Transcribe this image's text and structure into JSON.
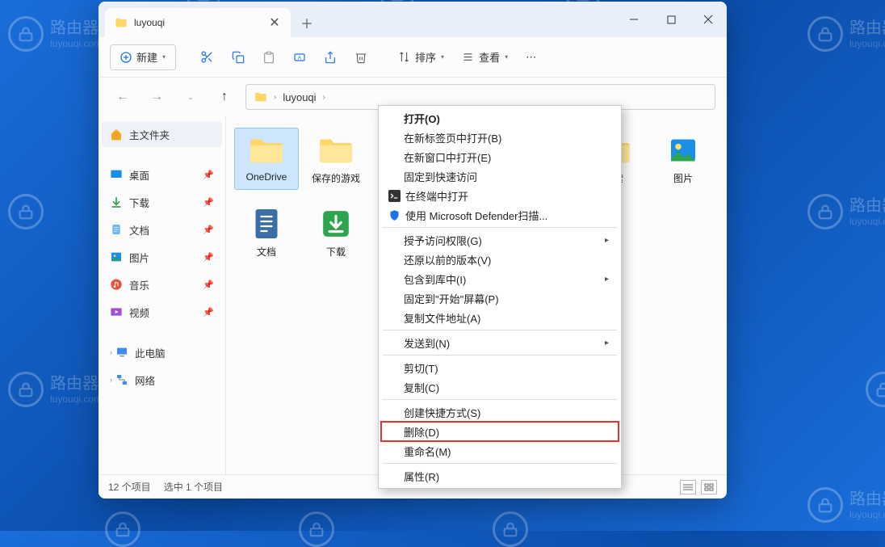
{
  "watermark": {
    "cn": "路由器",
    "url": "luyouqi.com"
  },
  "window": {
    "tab_label": "luyouqi",
    "toolbar": {
      "new": "新建",
      "sort": "排序",
      "view": "查看"
    },
    "breadcrumb": {
      "path": "luyouqi"
    },
    "sidebar": {
      "home": "主文件夹",
      "desktop": "桌面",
      "downloads": "下载",
      "documents": "文档",
      "pictures": "图片",
      "music": "音乐",
      "videos": "视频",
      "thispc": "此电脑",
      "network": "网络"
    },
    "items": {
      "onedrive": "OneDrive",
      "saved_games": "保存的游戏",
      "search": "搜索",
      "pictures": "图片",
      "documents": "文档",
      "downloads": "下载"
    },
    "status": {
      "count": "12 个项目",
      "selected": "选中 1 个项目"
    }
  },
  "context_menu": {
    "open": "打开(O)",
    "open_new_tab": "在新标签页中打开(B)",
    "open_new_window": "在新窗口中打开(E)",
    "pin_quick_access": "固定到快速访问",
    "open_terminal": "在终端中打开",
    "defender_scan": "使用 Microsoft Defender扫描...",
    "give_access": "授予访问权限(G)",
    "restore_versions": "还原以前的版本(V)",
    "include_library": "包含到库中(I)",
    "pin_start": "固定到\"开始\"屏幕(P)",
    "copy_path": "复制文件地址(A)",
    "send_to": "发送到(N)",
    "cut": "剪切(T)",
    "copy": "复制(C)",
    "create_shortcut": "创建快捷方式(S)",
    "delete": "删除(D)",
    "rename": "重命名(M)",
    "properties": "属性(R)"
  }
}
